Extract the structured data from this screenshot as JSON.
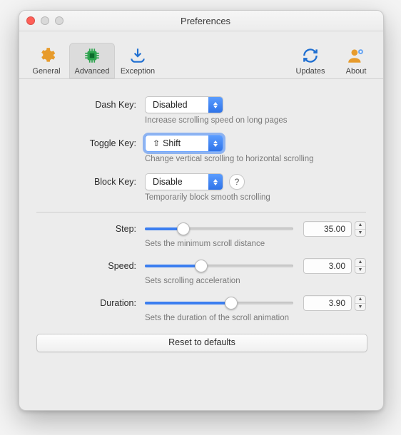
{
  "window": {
    "title": "Preferences"
  },
  "toolbar": {
    "tabs": [
      {
        "id": "general",
        "label": "General",
        "icon": "gear-icon"
      },
      {
        "id": "advanced",
        "label": "Advanced",
        "icon": "chip-icon"
      },
      {
        "id": "exception",
        "label": "Exception",
        "icon": "download-icon"
      },
      {
        "id": "updates",
        "label": "Updates",
        "icon": "refresh-icon"
      },
      {
        "id": "about",
        "label": "About",
        "icon": "person-gear-icon"
      }
    ],
    "selected": "advanced"
  },
  "fields": {
    "dash_key": {
      "label": "Dash Key:",
      "value": "Disabled",
      "hint": "Increase scrolling speed on long pages"
    },
    "toggle_key": {
      "label": "Toggle Key:",
      "glyph": "⇧",
      "value": "Shift",
      "hint": "Change vertical scrolling to horizontal scrolling"
    },
    "block_key": {
      "label": "Block Key:",
      "value": "Disable",
      "hint": "Temporarily block smooth scrolling",
      "help": "?"
    }
  },
  "sliders": {
    "step": {
      "label": "Step:",
      "value": "35.00",
      "fill_pct": 26,
      "hint": "Sets the minimum scroll distance"
    },
    "speed": {
      "label": "Speed:",
      "value": "3.00",
      "fill_pct": 38,
      "hint": "Sets scrolling acceleration"
    },
    "duration": {
      "label": "Duration:",
      "value": "3.90",
      "fill_pct": 58,
      "hint": "Sets the duration of the scroll animation"
    }
  },
  "reset_label": "Reset to defaults",
  "colors": {
    "accent": "#3b7ef0"
  }
}
